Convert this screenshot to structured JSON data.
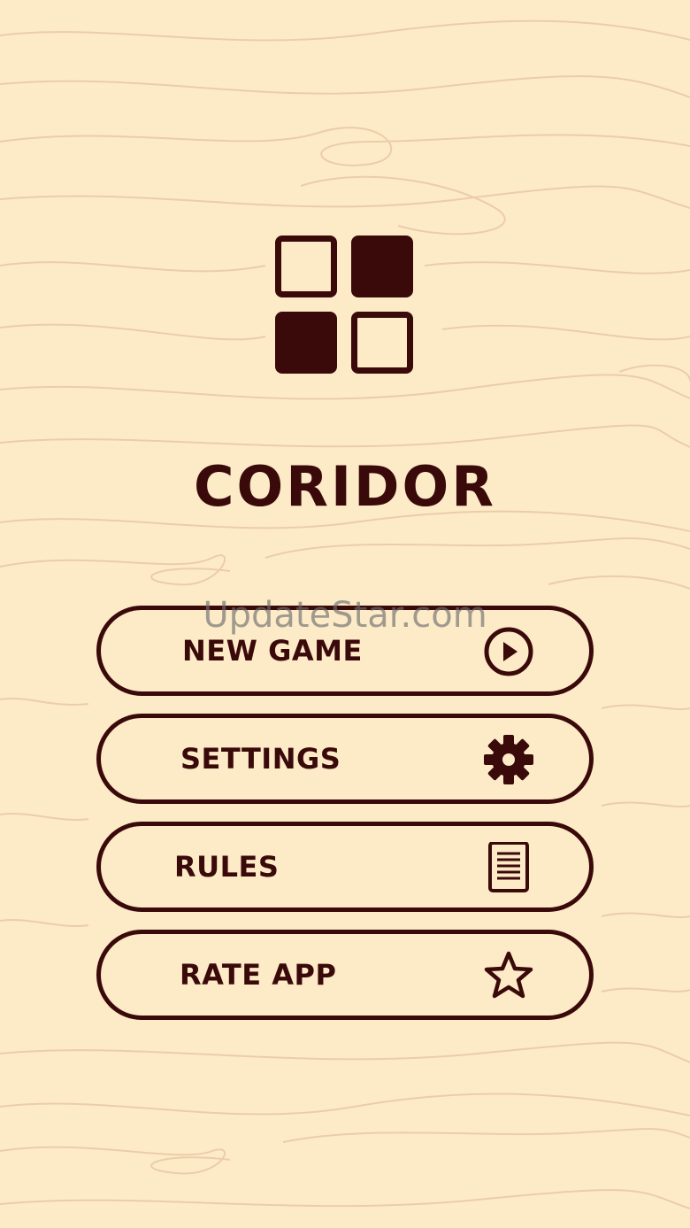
{
  "app": {
    "title": "CORIDOR",
    "watermark": "UpdateStar.com"
  },
  "menu": {
    "items": [
      {
        "label": "NEW GAME",
        "icon": "play-circle-icon"
      },
      {
        "label": "SETTINGS",
        "icon": "gear-icon"
      },
      {
        "label": "RULES",
        "icon": "document-icon"
      },
      {
        "label": "RATE APP",
        "icon": "star-icon"
      }
    ]
  },
  "colors": {
    "background": "#FDEBC8",
    "ink": "#3A0A0A",
    "wood_grain": "#E8C4A0"
  }
}
